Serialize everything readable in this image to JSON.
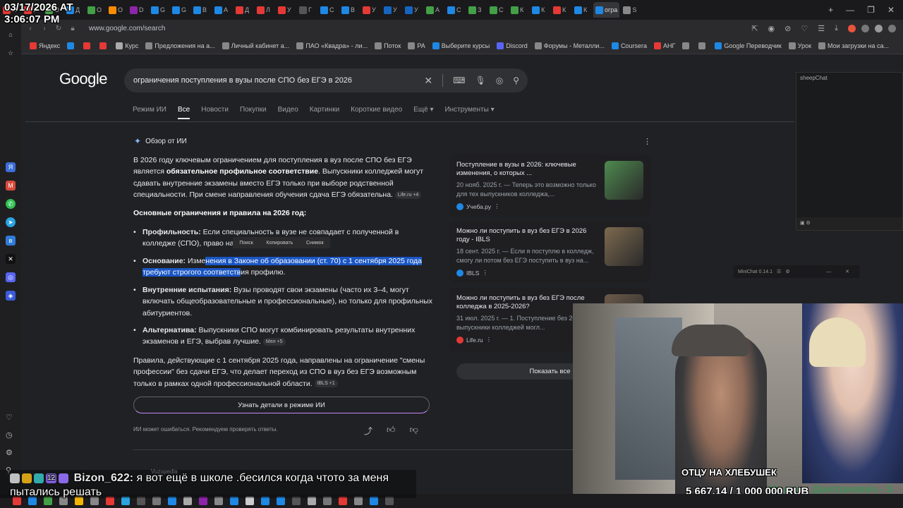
{
  "overlay": {
    "date": "03/17/2026 AT",
    "time": "3:06:07 PM"
  },
  "browser": {
    "url": "www.google.com/search",
    "tabs": [
      {
        "label": "П",
        "color": "#e53935"
      },
      {
        "label": "У",
        "color": "#e53935"
      },
      {
        "label": "О",
        "color": "#43a047"
      },
      {
        "label": "Д",
        "color": "#1e88e5"
      },
      {
        "label": "О",
        "color": "#43a047"
      },
      {
        "label": "О",
        "color": "#fb8c00"
      },
      {
        "label": "D",
        "color": "#8e24aa"
      },
      {
        "label": "G",
        "color": "#1e88e5"
      },
      {
        "label": "G",
        "color": "#1e88e5"
      },
      {
        "label": "В",
        "color": "#1e88e5"
      },
      {
        "label": "А",
        "color": "#1e88e5"
      },
      {
        "label": "Д",
        "color": "#e53935"
      },
      {
        "label": "Л",
        "color": "#e53935"
      },
      {
        "label": "У",
        "color": "#e53935"
      },
      {
        "label": "Г",
        "color": "#555"
      },
      {
        "label": "С",
        "color": "#1e88e5"
      },
      {
        "label": "В",
        "color": "#1e88e5"
      },
      {
        "label": "У",
        "color": "#e53935"
      },
      {
        "label": "У",
        "color": "#1565c0"
      },
      {
        "label": "У",
        "color": "#1565c0"
      },
      {
        "label": "А",
        "color": "#43a047"
      },
      {
        "label": "С",
        "color": "#1e88e5"
      },
      {
        "label": "З",
        "color": "#43a047"
      },
      {
        "label": "С",
        "color": "#43a047"
      },
      {
        "label": "К",
        "color": "#43a047"
      },
      {
        "label": "К",
        "color": "#1e88e5"
      },
      {
        "label": "К",
        "color": "#e53935"
      },
      {
        "label": "К",
        "color": "#1e88e5"
      },
      {
        "label": "огра",
        "color": "#1e88e5"
      },
      {
        "label": "S",
        "color": "#888"
      }
    ],
    "bookmarks": [
      {
        "label": "Яндекс",
        "color": "#e53935"
      },
      {
        "label": "",
        "color": "#1e88e5"
      },
      {
        "label": "",
        "color": "#e53935"
      },
      {
        "label": "",
        "color": "#e53935"
      },
      {
        "label": "Курс",
        "color": "#aaa"
      },
      {
        "label": "Предложения на а...",
        "color": "#888"
      },
      {
        "label": "Личный кабинет а...",
        "color": "#888"
      },
      {
        "label": "ПАО «Квадра» - ли...",
        "color": "#888"
      },
      {
        "label": "Поток",
        "color": "#888"
      },
      {
        "label": "РА",
        "color": "#888"
      },
      {
        "label": "Выберите курсы",
        "color": "#1e88e5"
      },
      {
        "label": "Discord",
        "color": "#5865f2"
      },
      {
        "label": "Форумы - Металли...",
        "color": "#888"
      },
      {
        "label": "Coursera",
        "color": "#1e88e5"
      },
      {
        "label": "АНГ",
        "color": "#e53935"
      },
      {
        "label": "",
        "color": "#888"
      },
      {
        "label": "",
        "color": "#888"
      },
      {
        "label": "Google Переводчик",
        "color": "#1e88e5"
      },
      {
        "label": "Урок",
        "color": "#888"
      },
      {
        "label": "Мои загрузки на са...",
        "color": "#888"
      }
    ]
  },
  "google": {
    "logo": "Google",
    "query": "ограничения поступления в вузы после СПО без ЕГЭ в 2026",
    "tabs": [
      "Режим ИИ",
      "Все",
      "Новости",
      "Покупки",
      "Видео",
      "Картинки",
      "Короткие видео",
      "Ещё ▾",
      "Инструменты ▾"
    ],
    "ai": {
      "heading": "Обзор от ИИ",
      "intro_1": "В 2026 году ключевым ограничением для поступления в вуз после СПО без ЕГЭ является ",
      "intro_bold": "обязательное профильное соответствие",
      "intro_2": ". Выпускники колледжей могут сдавать внутренние экзамены вместо ЕГЭ только при выборе родственной специальности. При смене направления обучения сдача ЕГЭ обязательна.",
      "intro_chip": "Life.ru +4",
      "subheading": "Основные ограничения и правила на 2026 год:",
      "b1_title": "Профильность:",
      "b1_text": " Если специальность в вузе не совпадает с полученной в колледже (СПО), право на ... ся, и требуется ЕГЭ.",
      "ctx": [
        "Поиск",
        "Копировать",
        "Снимок"
      ],
      "b2_title": "Основание:",
      "b2_pre": " Изме",
      "b2_hl": "нения в Законе об образовании (ст. 70) с 1 сентября 2025 года требуют строгого соответств",
      "b2_post": "ия профилю.",
      "b3_title": "Внутренние испытания:",
      "b3_text": " Вузы проводят свои экзамены (часто их 3–4, могут включать общеобразовательные и профессиональные), но только для профильных абитуриентов.",
      "b4_title": "Альтернатива:",
      "b4_text": " Выпускники СПО могут комбинировать результаты внутренних экзаменов и ЕГЭ, выбрав лучшие.",
      "b4_chip": "Мел +5",
      "outro": "Правила, действующие с 1 сентября 2025 года, направлены на ограничение \"смены профессии\" без сдачи ЕГЭ, что делает переход из СПО в вуз без ЕГЭ возможным только в рамках одной профессиональной области.",
      "outro_chip": "IBLS +1",
      "more_button": "Узнать детали в режиме ИИ",
      "disclaimer": "ИИ может ошибаться. Рекомендуем проверять ответы."
    },
    "cards": [
      {
        "title": "Поступление в вузы в 2026: ключевые изменения, о которых ...",
        "desc": "20 нояб. 2025 г. — Теперь это возможно только для тех выпускников колледжа,...",
        "source": "Учеба.ру",
        "src_color": "#1e88e5",
        "thumb": "#4e8a4f"
      },
      {
        "title": "Можно ли поступить в вуз без ЕГЭ в 2026 году - IBLS",
        "desc": "18 сент. 2025 г. — Если я поступлю в колледж, смогу ли потом без ЕГЭ поступить в вуз на...",
        "source": "IBLS",
        "src_color": "#1e88e5",
        "thumb": "#7d6a4f"
      },
      {
        "title": "Можно ли поступить в вуз без ЕГЭ после колледжа в 2025-2026?",
        "desc": "31 июл. 2025 г. — 1. Поступление без 2025 году выпускники колледжей могл...",
        "source": "Life.ru",
        "src_color": "#e53935",
        "thumb": "#6b5a4a"
      }
    ],
    "show_all": "Показать все",
    "vuzopedia": "Vuzopedia"
  },
  "chat_panel": {
    "title": "sheepChat"
  },
  "minichat": {
    "title": "MiniChat 0.14.1"
  },
  "stream": {
    "label": "ОТЦУ НА ХЛЕБУШЕК",
    "donation": "5 667.14 / 1 000 000 RUB",
    "donor": "Максим Дмитриевич - 5"
  },
  "chat_overlay": {
    "badge_count": "12",
    "user": "Bizon_622:",
    "message": " я вот ещё в школе .бесился когда чтото за меня пытались решать"
  }
}
